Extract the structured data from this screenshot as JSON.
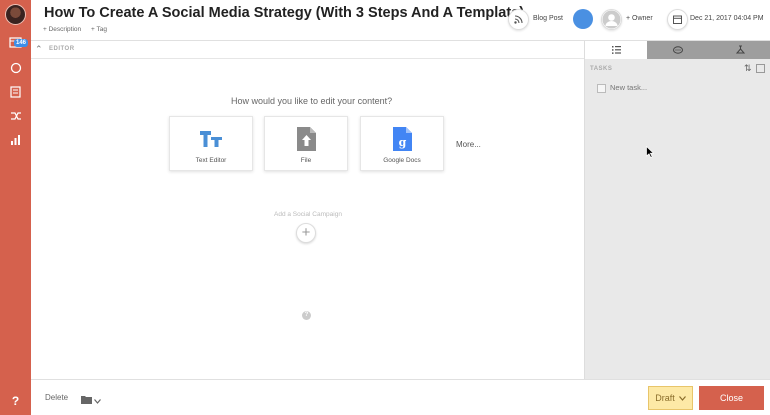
{
  "header": {
    "title": "How To Create A Social Media Strategy (With 3 Steps And A Template)",
    "add_description": "+ Description",
    "add_tag": "+ Tag",
    "content_type": "Blog Post",
    "owner_label": "+ Owner",
    "date": "Dec 21, 2017 04:04 PM"
  },
  "sidebar": {
    "badge": "146"
  },
  "editor": {
    "section_label": "EDITOR",
    "prompt": "How would you like to edit your content?",
    "options": [
      {
        "label": "Text Editor",
        "icon": "text-editor-icon"
      },
      {
        "label": "File",
        "icon": "file-upload-icon"
      },
      {
        "label": "Google Docs",
        "icon": "google-docs-icon"
      }
    ],
    "more": "More...",
    "social_campaign": "Add a Social Campaign",
    "add_symbol": "+",
    "help_symbol": "?"
  },
  "tasks": {
    "label": "TASKS",
    "new_task_placeholder": "New task..."
  },
  "footer": {
    "delete": "Delete",
    "draft": "Draft",
    "close": "Close",
    "help": "?"
  },
  "colors": {
    "brand": "#d5614d",
    "accent_blue": "#4a90e2",
    "draft_bg": "#fde9a6"
  }
}
